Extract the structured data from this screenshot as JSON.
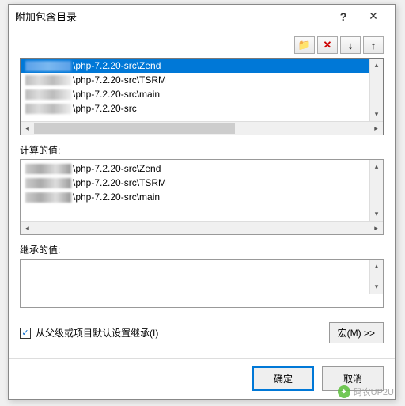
{
  "title": "附加包含目录",
  "toolbar": {
    "new_folder": "📁",
    "delete": "✕",
    "move_down": "↓",
    "move_up": "↑"
  },
  "list": {
    "items": [
      "\\php-7.2.20-src\\Zend",
      "\\php-7.2.20-src\\TSRM",
      "\\php-7.2.20-src\\main",
      "\\php-7.2.20-src"
    ],
    "selected_index": 0
  },
  "evaluated": {
    "label": "计算的值:",
    "items": [
      "\\php-7.2.20-src\\Zend",
      "\\php-7.2.20-src\\TSRM",
      "\\php-7.2.20-src\\main"
    ]
  },
  "inherited": {
    "label": "继承的值:"
  },
  "inherit_check": {
    "checked": true,
    "label": "从父级或项目默认设置继承(I)"
  },
  "macro_button": "宏(M) >>",
  "buttons": {
    "ok": "确定",
    "cancel": "取消"
  },
  "watermark": "码农UP2U"
}
